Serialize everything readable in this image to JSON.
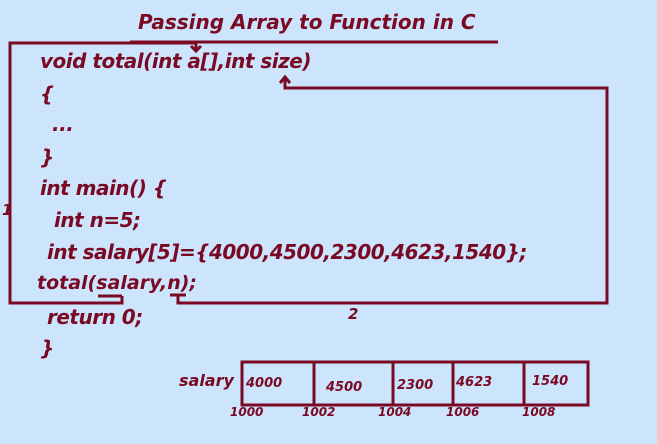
{
  "title": "Passing Array to Function in C",
  "code_lines": [
    "void total(int a[],int size)",
    "{",
    "...",
    "}",
    "int main() {",
    "int n=5;",
    "int salary[5]={4000,4500,2300,4623,1540};",
    "total(salary,n);",
    "return 0;",
    "}"
  ],
  "arrow_labels": [
    "1",
    "2"
  ],
  "array": {
    "name": "salary",
    "values": [
      "4000",
      "4500",
      "2300",
      "4623",
      "1540"
    ],
    "addresses": [
      "1000",
      "1002",
      "1004",
      "1006",
      "1008"
    ]
  },
  "colors": {
    "background": "#cde5fc",
    "ink": "#7a0a24"
  }
}
